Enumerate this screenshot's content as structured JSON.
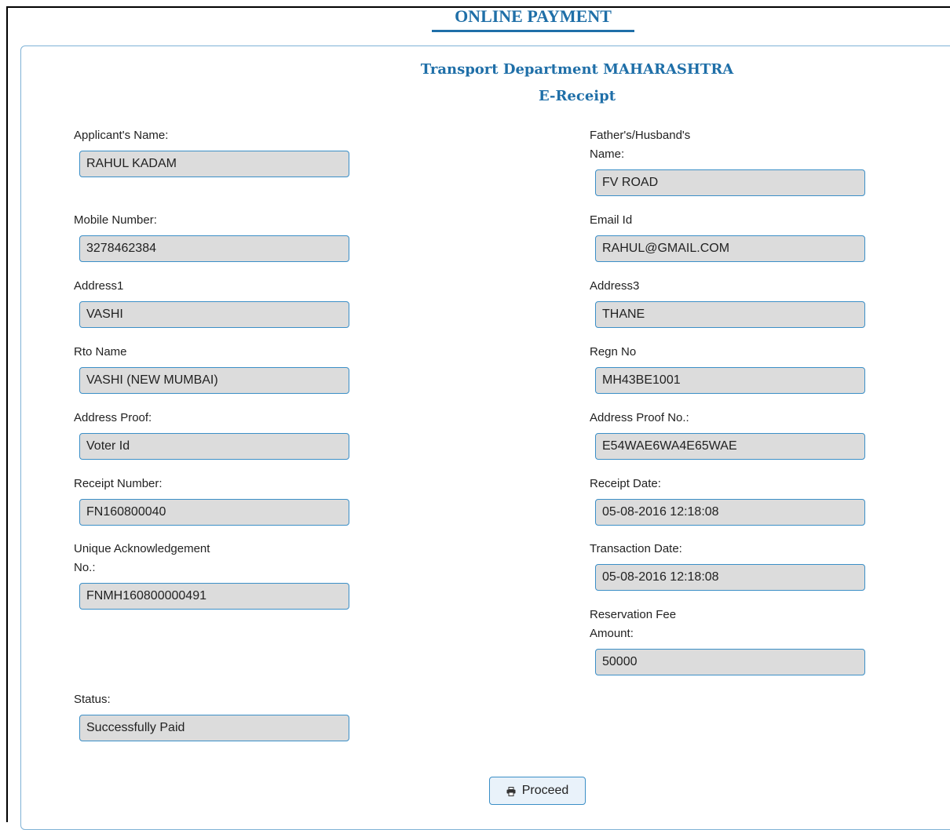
{
  "page": {
    "heading": "ONLINE PAYMENT"
  },
  "receipt": {
    "department": "Transport Department MAHARASHTRA",
    "subtitle": "E-Receipt",
    "fields": {
      "applicant_name": {
        "label": "Applicant's Name:",
        "value": "RAHUL KADAM"
      },
      "father_husband_name": {
        "label": "Father's/Husband's Name:",
        "value": "FV ROAD"
      },
      "mobile_number": {
        "label": "Mobile Number:",
        "value": "3278462384"
      },
      "email_id": {
        "label": "Email Id",
        "value": "RAHUL@GMAIL.COM"
      },
      "address1": {
        "label": "Address1",
        "value": "VASHI"
      },
      "address3": {
        "label": "Address3",
        "value": "THANE"
      },
      "rto_name": {
        "label": "Rto Name",
        "value": "VASHI (NEW MUMBAI)"
      },
      "regn_no": {
        "label": "Regn No",
        "value": "MH43BE1001"
      },
      "address_proof": {
        "label": "Address Proof:",
        "value": "Voter Id"
      },
      "address_proof_no": {
        "label": "Address Proof No.:",
        "value": "E54WAE6WA4E65WAE"
      },
      "receipt_number": {
        "label": "Receipt Number:",
        "value": "FN160800040"
      },
      "receipt_date": {
        "label": "Receipt Date:",
        "value": "05-08-2016 12:18:08"
      },
      "unique_ack_no": {
        "label": "Unique Acknowledgement No.:",
        "value": "FNMH160800000491"
      },
      "transaction_date": {
        "label": "Transaction Date:",
        "value": "05-08-2016 12:18:08"
      },
      "reservation_fee": {
        "label": "Reservation Fee Amount:",
        "value": "50000"
      },
      "status": {
        "label": "Status:",
        "value": "Successfully Paid"
      }
    },
    "proceed_label": "Proceed",
    "proceed_icon": "print-icon"
  },
  "colors": {
    "accent": "#1f6fa8",
    "input_border": "#3b8fc7",
    "input_bg": "#dcdcdc"
  }
}
